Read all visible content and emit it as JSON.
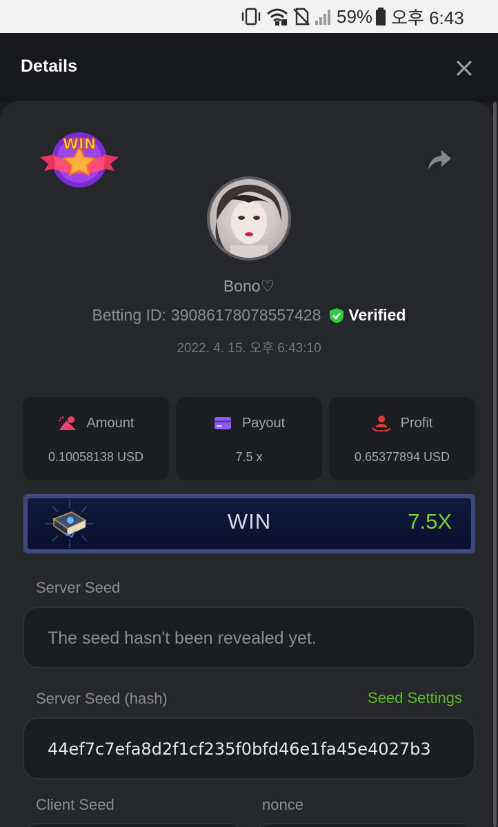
{
  "status_bar": {
    "battery_percent": "59%",
    "time": "오후 6:43",
    "icons": [
      "vibrate-icon",
      "wifi-icon",
      "no-sim-icon",
      "signal-icon",
      "battery-icon"
    ]
  },
  "header": {
    "title": "Details",
    "close_icon": "close-icon"
  },
  "bet": {
    "badge": "WIN",
    "username": "Bono♡",
    "betting_id_label": "Betting ID:",
    "betting_id": "390861780785574​28",
    "verified_label": "Verified",
    "date": "2022. 4. 15. 오후 6:43:10"
  },
  "stats": [
    {
      "label": "Amount",
      "value": "0.10058138 USD",
      "icon": "coins-icon",
      "color": "#e8416a"
    },
    {
      "label": "Payout",
      "value": "7.5 x",
      "icon": "card-icon",
      "color": "#8b5cf6"
    },
    {
      "label": "Profit",
      "value": "0.65377894 USD",
      "icon": "hand-user-icon",
      "color": "#e5383b"
    }
  ],
  "result": {
    "word": "WIN",
    "multiplier": "7.5X",
    "icon": "spellbook-icon"
  },
  "server_seed": {
    "label": "Server Seed",
    "value": "The seed hasn't been revealed yet."
  },
  "server_seed_hash": {
    "label": "Server Seed (hash)",
    "action": "Seed Settings",
    "value": "44ef7c7efa8d2f1cf235f0bfd46e1fa45e4027b3"
  },
  "client_seed": {
    "label": "Client Seed"
  },
  "nonce": {
    "label": "nonce"
  },
  "colors": {
    "accent_green": "#5fbb2a",
    "multiplier_green": "#7bd42c",
    "verified_shield": "#2ecc40"
  }
}
